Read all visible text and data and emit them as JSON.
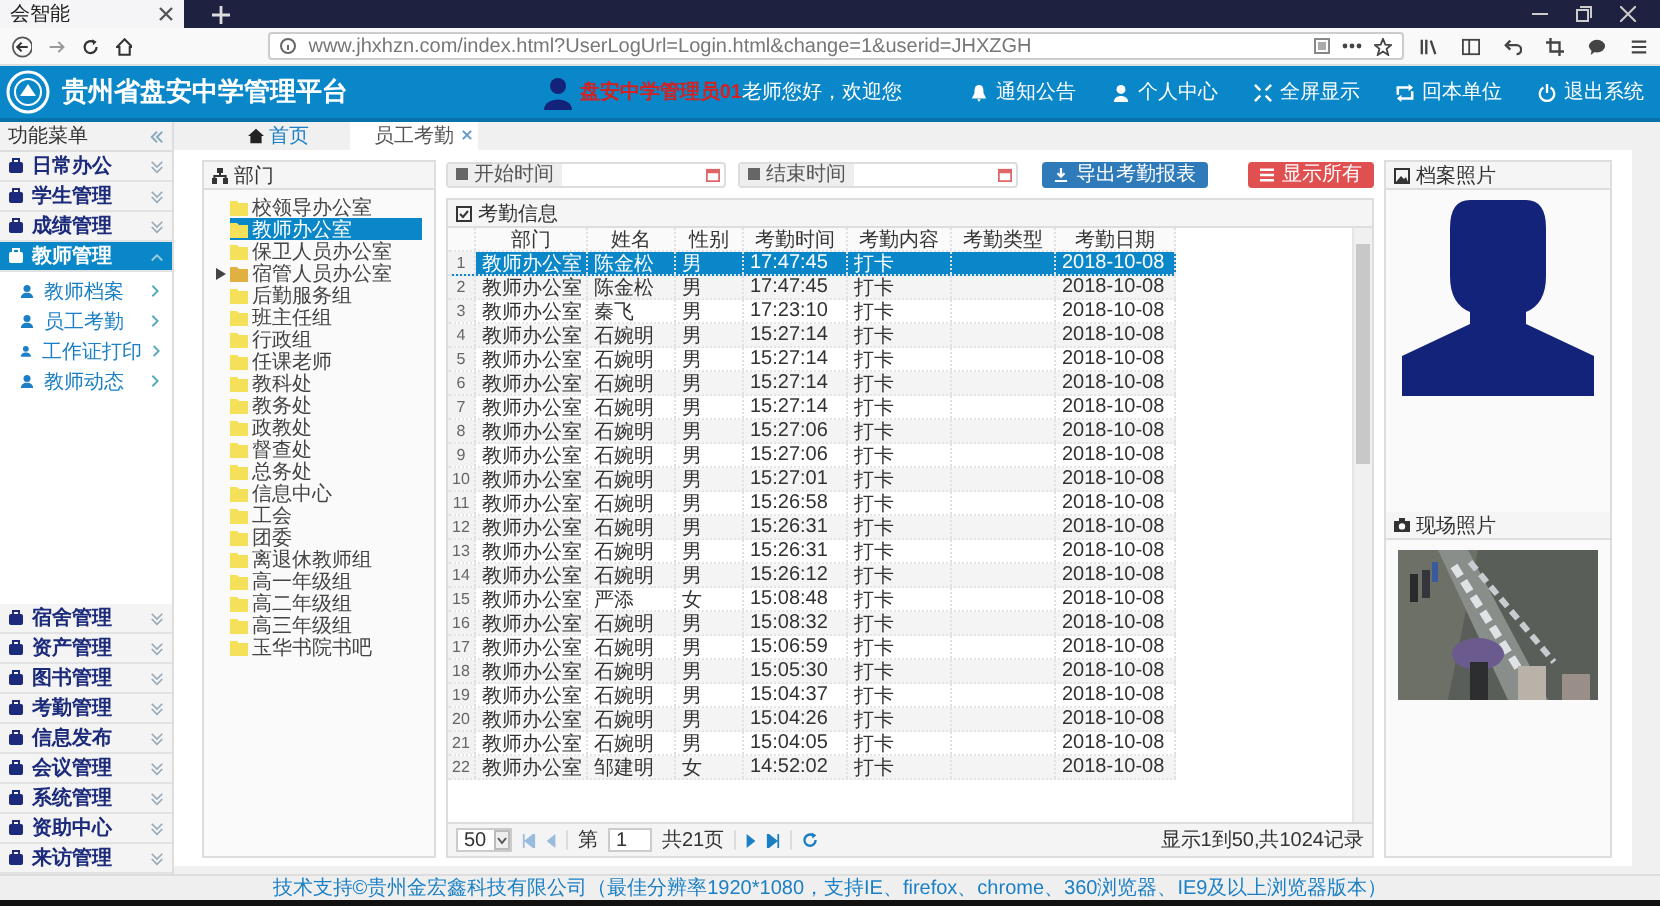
{
  "browser": {
    "tab_title": "会智能",
    "url": "www.jhxhzn.com/index.html?UserLogUrl=Login.html&change=1&userid=JHXZGH"
  },
  "header": {
    "title": "贵州省盘安中学管理平台",
    "user": "盘安中学管理员01",
    "greeting": "老师您好，欢迎您",
    "nav": [
      {
        "kind": "bell",
        "label": "通知公告"
      },
      {
        "kind": "person",
        "label": "个人中心"
      },
      {
        "kind": "fullscreen",
        "label": "全屏显示"
      },
      {
        "kind": "switch",
        "label": "回本单位"
      },
      {
        "kind": "power",
        "label": "退出系统"
      }
    ]
  },
  "sidebar": {
    "title": "功能菜单",
    "groups": [
      {
        "label": "日常办公",
        "expanded": false
      },
      {
        "label": "学生管理",
        "expanded": false
      },
      {
        "label": "成绩管理",
        "expanded": false
      },
      {
        "label": "教师管理",
        "expanded": true,
        "children": [
          {
            "label": "教师档案"
          },
          {
            "label": "员工考勤"
          },
          {
            "label": "工作证打印"
          },
          {
            "label": "教师动态"
          }
        ]
      },
      {
        "label": "宿舍管理",
        "expanded": false
      },
      {
        "label": "资产管理",
        "expanded": false
      },
      {
        "label": "图书管理",
        "expanded": false
      },
      {
        "label": "考勤管理",
        "expanded": false
      },
      {
        "label": "信息发布",
        "expanded": false
      },
      {
        "label": "会议管理",
        "expanded": false
      },
      {
        "label": "系统管理",
        "expanded": false
      },
      {
        "label": "资助中心",
        "expanded": false
      },
      {
        "label": "来访管理",
        "expanded": false
      }
    ]
  },
  "tabs": [
    {
      "kind": "home",
      "label": "首页",
      "selected": false
    },
    {
      "kind": "page",
      "label": "员工考勤",
      "selected": true
    }
  ],
  "tree": {
    "title": "部门",
    "items": [
      {
        "label": "校领导办公室",
        "selected": false,
        "expandable": false
      },
      {
        "label": "教师办公室",
        "selected": true,
        "expandable": false
      },
      {
        "label": "保卫人员办公室",
        "selected": false,
        "expandable": false
      },
      {
        "label": "宿管人员办公室",
        "selected": false,
        "expandable": true
      },
      {
        "label": "后勤服务组",
        "selected": false,
        "expandable": false
      },
      {
        "label": "班主任组",
        "selected": false,
        "expandable": false
      },
      {
        "label": "行政组",
        "selected": false,
        "expandable": false
      },
      {
        "label": "任课老师",
        "selected": false,
        "expandable": false
      },
      {
        "label": "教科处",
        "selected": false,
        "expandable": false
      },
      {
        "label": "教务处",
        "selected": false,
        "expandable": false
      },
      {
        "label": "政教处",
        "selected": false,
        "expandable": false
      },
      {
        "label": "督查处",
        "selected": false,
        "expandable": false
      },
      {
        "label": "总务处",
        "selected": false,
        "expandable": false
      },
      {
        "label": "信息中心",
        "selected": false,
        "expandable": false
      },
      {
        "label": "工会",
        "selected": false,
        "expandable": false
      },
      {
        "label": "团委",
        "selected": false,
        "expandable": false
      },
      {
        "label": "离退休教师组",
        "selected": false,
        "expandable": false
      },
      {
        "label": "高一年级组",
        "selected": false,
        "expandable": false
      },
      {
        "label": "高二年级组",
        "selected": false,
        "expandable": false
      },
      {
        "label": "高三年级组",
        "selected": false,
        "expandable": false
      },
      {
        "label": "玉华书院书吧",
        "selected": false,
        "expandable": false
      }
    ]
  },
  "filters": {
    "start_label": "开始时间",
    "end_label": "结束时间",
    "export_button": "导出考勤报表",
    "show_all_button": "显示所有"
  },
  "grid": {
    "title": "考勤信息",
    "columns": [
      "部门",
      "姓名",
      "性别",
      "考勤时间",
      "考勤内容",
      "考勤类型",
      "考勤日期"
    ],
    "rows": [
      {
        "n": "1",
        "dept": "教师办公室",
        "name": "陈金松",
        "sex": "男",
        "time": "17:47:45",
        "content": "打卡",
        "date": "2018-10-08",
        "selected": true
      },
      {
        "n": "2",
        "dept": "教师办公室",
        "name": "陈金松",
        "sex": "男",
        "time": "17:47:45",
        "content": "打卡",
        "date": "2018-10-08",
        "selected": false
      },
      {
        "n": "3",
        "dept": "教师办公室",
        "name": "秦飞",
        "sex": "男",
        "time": "17:23:10",
        "content": "打卡",
        "date": "2018-10-08",
        "selected": false
      },
      {
        "n": "4",
        "dept": "教师办公室",
        "name": "石婉明",
        "sex": "男",
        "time": "15:27:14",
        "content": "打卡",
        "date": "2018-10-08",
        "selected": false
      },
      {
        "n": "5",
        "dept": "教师办公室",
        "name": "石婉明",
        "sex": "男",
        "time": "15:27:14",
        "content": "打卡",
        "date": "2018-10-08",
        "selected": false
      },
      {
        "n": "6",
        "dept": "教师办公室",
        "name": "石婉明",
        "sex": "男",
        "time": "15:27:14",
        "content": "打卡",
        "date": "2018-10-08",
        "selected": false
      },
      {
        "n": "7",
        "dept": "教师办公室",
        "name": "石婉明",
        "sex": "男",
        "time": "15:27:14",
        "content": "打卡",
        "date": "2018-10-08",
        "selected": false
      },
      {
        "n": "8",
        "dept": "教师办公室",
        "name": "石婉明",
        "sex": "男",
        "time": "15:27:06",
        "content": "打卡",
        "date": "2018-10-08",
        "selected": false
      },
      {
        "n": "9",
        "dept": "教师办公室",
        "name": "石婉明",
        "sex": "男",
        "time": "15:27:06",
        "content": "打卡",
        "date": "2018-10-08",
        "selected": false
      },
      {
        "n": "10",
        "dept": "教师办公室",
        "name": "石婉明",
        "sex": "男",
        "time": "15:27:01",
        "content": "打卡",
        "date": "2018-10-08",
        "selected": false
      },
      {
        "n": "11",
        "dept": "教师办公室",
        "name": "石婉明",
        "sex": "男",
        "time": "15:26:58",
        "content": "打卡",
        "date": "2018-10-08",
        "selected": false
      },
      {
        "n": "12",
        "dept": "教师办公室",
        "name": "石婉明",
        "sex": "男",
        "time": "15:26:31",
        "content": "打卡",
        "date": "2018-10-08",
        "selected": false
      },
      {
        "n": "13",
        "dept": "教师办公室",
        "name": "石婉明",
        "sex": "男",
        "time": "15:26:31",
        "content": "打卡",
        "date": "2018-10-08",
        "selected": false
      },
      {
        "n": "14",
        "dept": "教师办公室",
        "name": "石婉明",
        "sex": "男",
        "time": "15:26:12",
        "content": "打卡",
        "date": "2018-10-08",
        "selected": false
      },
      {
        "n": "15",
        "dept": "教师办公室",
        "name": "严添",
        "sex": "女",
        "time": "15:08:48",
        "content": "打卡",
        "date": "2018-10-08",
        "selected": false
      },
      {
        "n": "16",
        "dept": "教师办公室",
        "name": "石婉明",
        "sex": "男",
        "time": "15:08:32",
        "content": "打卡",
        "date": "2018-10-08",
        "selected": false
      },
      {
        "n": "17",
        "dept": "教师办公室",
        "name": "石婉明",
        "sex": "男",
        "time": "15:06:59",
        "content": "打卡",
        "date": "2018-10-08",
        "selected": false
      },
      {
        "n": "18",
        "dept": "教师办公室",
        "name": "石婉明",
        "sex": "男",
        "time": "15:05:30",
        "content": "打卡",
        "date": "2018-10-08",
        "selected": false
      },
      {
        "n": "19",
        "dept": "教师办公室",
        "name": "石婉明",
        "sex": "男",
        "time": "15:04:37",
        "content": "打卡",
        "date": "2018-10-08",
        "selected": false
      },
      {
        "n": "20",
        "dept": "教师办公室",
        "name": "石婉明",
        "sex": "男",
        "time": "15:04:26",
        "content": "打卡",
        "date": "2018-10-08",
        "selected": false
      },
      {
        "n": "21",
        "dept": "教师办公室",
        "name": "石婉明",
        "sex": "男",
        "time": "15:04:05",
        "content": "打卡",
        "date": "2018-10-08",
        "selected": false
      },
      {
        "n": "22",
        "dept": "教师办公室",
        "name": "邹建明",
        "sex": "女",
        "time": "14:52:02",
        "content": "打卡",
        "date": "2018-10-08",
        "selected": false
      }
    ]
  },
  "pager": {
    "page_size": "50",
    "page_label": "第",
    "page": "1",
    "total_pages": "共21页",
    "summary": "显示1到50,共1024记录"
  },
  "photos": {
    "archive_title": "档案照片",
    "scene_title": "现场照片"
  },
  "footer": "技术支持©贵州金宏鑫科技有限公司（最佳分辨率1920*1080，支持IE、firefox、chrome、360浏览器、IE9及以上浏览器版本）"
}
